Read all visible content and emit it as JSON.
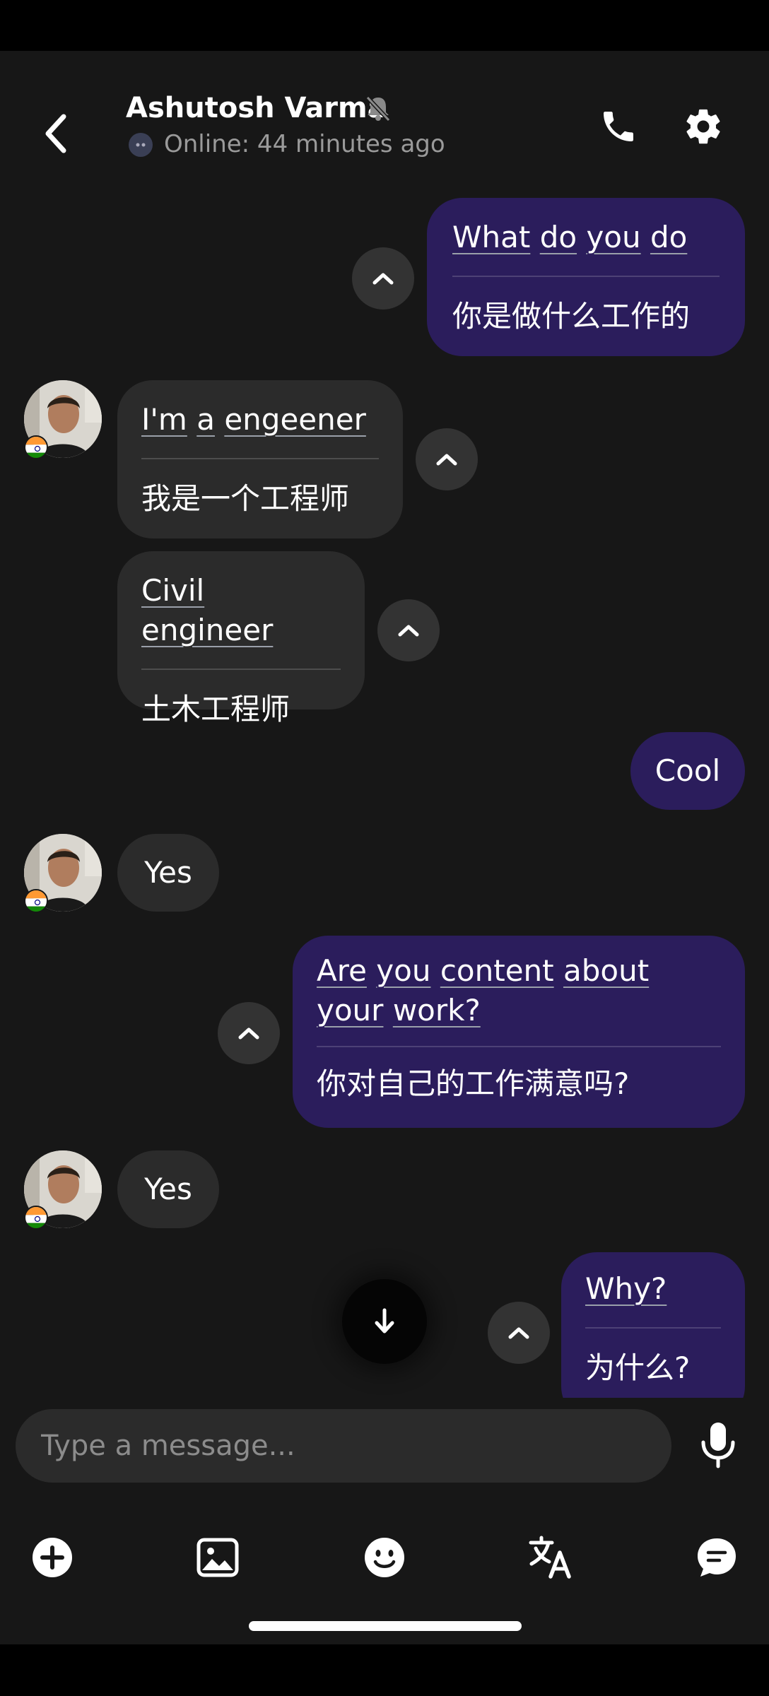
{
  "header": {
    "contact_name": "Ashutosh Varma",
    "status": "Online: 44 minutes ago"
  },
  "messages": [
    {
      "direction": "outgoing",
      "original": [
        "What",
        "do",
        "you",
        "do"
      ],
      "translation": "你是做什么工作的"
    },
    {
      "direction": "incoming",
      "original": [
        "I'm",
        "a",
        "engeener"
      ],
      "translation": "我是一个工程师"
    },
    {
      "direction": "incoming",
      "original": [
        "Civil",
        "engineer"
      ],
      "translation": "土木工程师"
    },
    {
      "direction": "outgoing",
      "text": "Cool"
    },
    {
      "direction": "incoming",
      "text": "Yes"
    },
    {
      "direction": "outgoing",
      "original": [
        "Are",
        "you",
        "content",
        "about",
        "your",
        "work?"
      ],
      "translation": "你对自己的工作满意吗?"
    },
    {
      "direction": "incoming",
      "text": "Yes"
    },
    {
      "direction": "outgoing",
      "original": [
        "Why?"
      ],
      "translation": "为什么?"
    }
  ],
  "composer": {
    "placeholder": "Type a message..."
  },
  "colors": {
    "background": "#171717",
    "outgoing_bubble": "#2b1d5c",
    "incoming_bubble": "#2b2b2b",
    "toggle_button": "#333333"
  },
  "icons": {
    "header": [
      "back-arrow-icon",
      "bell-muted-icon",
      "phone-icon",
      "gear-icon"
    ],
    "toolbar": [
      "add-circle-icon",
      "image-icon",
      "emoji-icon",
      "translate-icon",
      "chat-bubble-icon"
    ],
    "other": [
      "chevron-up-icon",
      "arrow-down-icon",
      "microphone-icon"
    ]
  }
}
